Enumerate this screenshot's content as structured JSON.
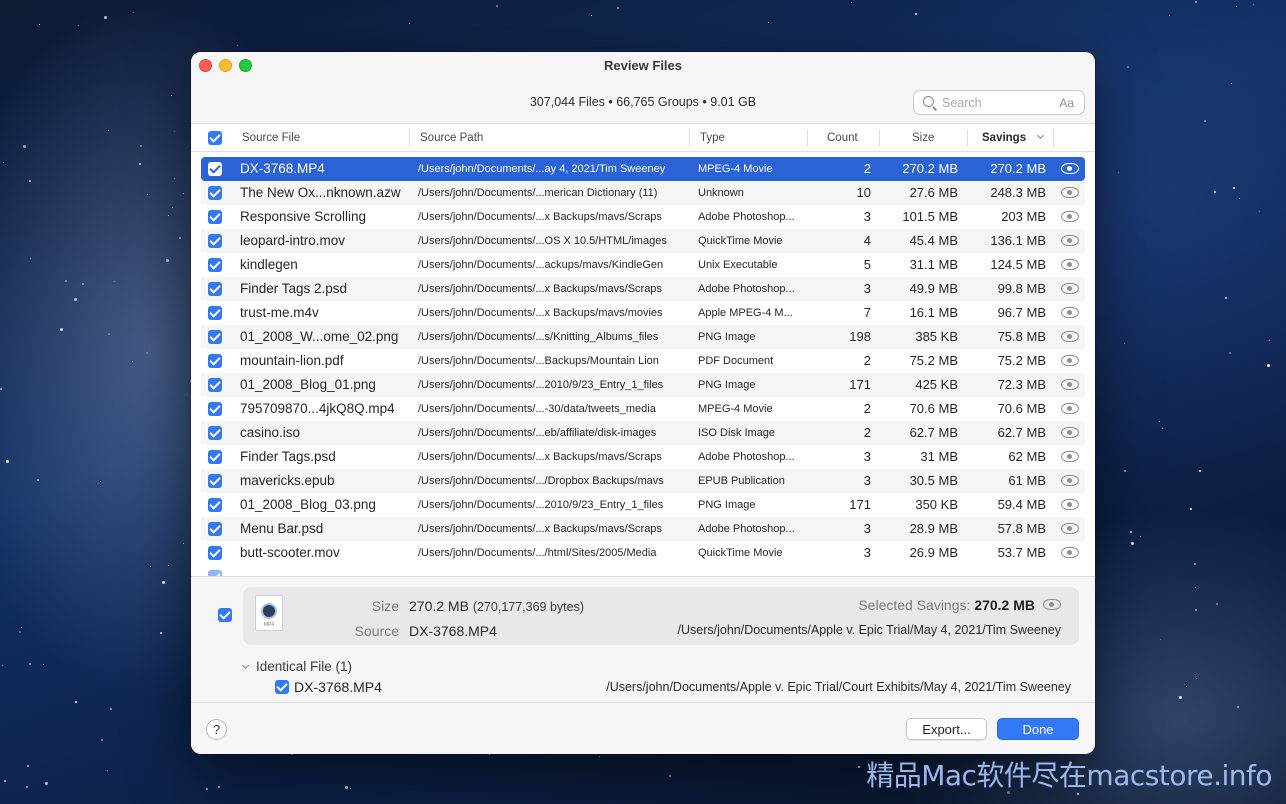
{
  "window": {
    "title": "Review Files",
    "summary": "307,044 Files • 66,765 Groups • 9.01 GB"
  },
  "search": {
    "placeholder": "Search",
    "case_toggle": "Aa"
  },
  "columns": {
    "source_file": "Source File",
    "source_path": "Source Path",
    "type": "Type",
    "count": "Count",
    "size": "Size",
    "savings": "Savings"
  },
  "rows": [
    {
      "name": "DX-3768.MP4",
      "path": "/Users/john/Documents/...ay 4, 2021/Tim Sweeney",
      "type": "MPEG-4 Movie",
      "count": "2",
      "size": "270.2 MB",
      "savings": "270.2 MB",
      "selected": true
    },
    {
      "name": "The New Ox...nknown.azw",
      "path": "/Users/john/Documents/...merican Dictionary (11)",
      "type": "Unknown",
      "count": "10",
      "size": "27.6 MB",
      "savings": "248.3 MB"
    },
    {
      "name": "Responsive Scrolling",
      "path": "/Users/john/Documents/...x Backups/mavs/Scraps",
      "type": "Adobe Photoshop...",
      "count": "3",
      "size": "101.5 MB",
      "savings": "203 MB"
    },
    {
      "name": "leopard-intro.mov",
      "path": "/Users/john/Documents/...OS X 10.5/HTML/images",
      "type": "QuickTime Movie",
      "count": "4",
      "size": "45.4 MB",
      "savings": "136.1 MB"
    },
    {
      "name": "kindlegen",
      "path": "/Users/john/Documents/...ackups/mavs/KindleGen",
      "type": "Unix Executable",
      "count": "5",
      "size": "31.1 MB",
      "savings": "124.5 MB"
    },
    {
      "name": "Finder Tags 2.psd",
      "path": "/Users/john/Documents/...x Backups/mavs/Scraps",
      "type": "Adobe Photoshop...",
      "count": "3",
      "size": "49.9 MB",
      "savings": "99.8 MB"
    },
    {
      "name": "trust-me.m4v",
      "path": "/Users/john/Documents/...x Backups/mavs/movies",
      "type": "Apple MPEG-4 M...",
      "count": "7",
      "size": "16.1 MB",
      "savings": "96.7 MB"
    },
    {
      "name": "01_2008_W...ome_02.png",
      "path": "/Users/john/Documents/...s/Knitting_Albums_files",
      "type": "PNG Image",
      "count": "198",
      "size": "385 KB",
      "savings": "75.8 MB"
    },
    {
      "name": "mountain-lion.pdf",
      "path": "/Users/john/Documents/...Backups/Mountain Lion",
      "type": "PDF Document",
      "count": "2",
      "size": "75.2 MB",
      "savings": "75.2 MB"
    },
    {
      "name": "01_2008_Blog_01.png",
      "path": "/Users/john/Documents/...2010/9/23_Entry_1_files",
      "type": "PNG Image",
      "count": "171",
      "size": "425 KB",
      "savings": "72.3 MB"
    },
    {
      "name": "795709870...4jkQ8Q.mp4",
      "path": "/Users/john/Documents/...-30/data/tweets_media",
      "type": "MPEG-4 Movie",
      "count": "2",
      "size": "70.6 MB",
      "savings": "70.6 MB"
    },
    {
      "name": "casino.iso",
      "path": "/Users/john/Documents/...eb/affiliate/disk-images",
      "type": "ISO Disk Image",
      "count": "2",
      "size": "62.7 MB",
      "savings": "62.7 MB"
    },
    {
      "name": "Finder Tags.psd",
      "path": "/Users/john/Documents/...x Backups/mavs/Scraps",
      "type": "Adobe Photoshop...",
      "count": "3",
      "size": "31 MB",
      "savings": "62 MB"
    },
    {
      "name": "mavericks.epub",
      "path": "/Users/john/Documents/.../Dropbox Backups/mavs",
      "type": "EPUB Publication",
      "count": "3",
      "size": "30.5 MB",
      "savings": "61 MB"
    },
    {
      "name": "01_2008_Blog_03.png",
      "path": "/Users/john/Documents/...2010/9/23_Entry_1_files",
      "type": "PNG Image",
      "count": "171",
      "size": "350 KB",
      "savings": "59.4 MB"
    },
    {
      "name": "Menu Bar.psd",
      "path": "/Users/john/Documents/...x Backups/mavs/Scraps",
      "type": "Adobe Photoshop...",
      "count": "3",
      "size": "28.9 MB",
      "savings": "57.8 MB"
    },
    {
      "name": "butt-scooter.mov",
      "path": "/Users/john/Documents/.../html/Sites/2005/Media",
      "type": "QuickTime Movie",
      "count": "3",
      "size": "26.9 MB",
      "savings": "53.7 MB"
    }
  ],
  "detail": {
    "size_label": "Size",
    "size_value": "270.2 MB",
    "size_bytes": "(270,177,369 bytes)",
    "source_label": "Source",
    "source_value": "DX-3768.MP4",
    "selected_savings_label": "Selected Savings:",
    "selected_savings_value": "270.2 MB",
    "source_path": "/Users/john/Documents/Apple v. Epic Trial/May 4, 2021/Tim Sweeney",
    "file_icon_ext": "MP4",
    "identical_header": "Identical File (1)",
    "identical_name": "DX-3768.MP4",
    "identical_path": "/Users/john/Documents/Apple v. Epic Trial/Court Exhibits/May 4, 2021/Tim Sweeney"
  },
  "footer": {
    "help_label": "?",
    "export_label": "Export...",
    "done_label": "Done"
  },
  "watermark": "精品Mac软件尽在macstore.info",
  "colors": {
    "accent": "#3478f6",
    "selection": "#2b62d6",
    "close": "#ff5f57",
    "minimize": "#febc2e",
    "zoom": "#28c840"
  }
}
